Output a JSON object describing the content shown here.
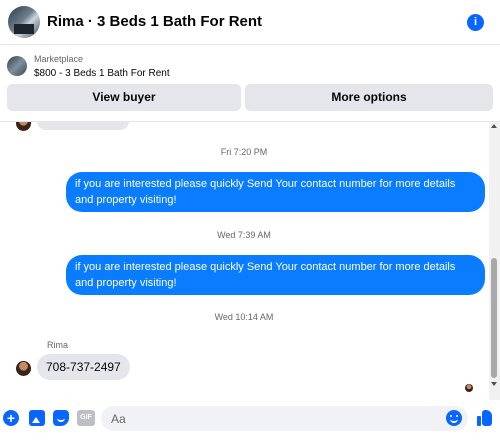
{
  "header": {
    "title": "Rima · 3 Beds 1 Bath For Rent",
    "info_icon": "info-icon"
  },
  "banner": {
    "category": "Marketplace",
    "listing": "$800 - 3 Beds 1 Bath For Rent",
    "view_buyer_label": "View buyer",
    "more_options_label": "More options"
  },
  "messages": {
    "ts1": "Fri 7:20 PM",
    "msg1": "if you are interested please quickly Send Your contact number for more details and property visiting!",
    "ts2": "Wed 7:39 AM",
    "msg2": "if you are interested please quickly Send Your contact number for more details and property visiting!",
    "ts3": "Wed 10:14 AM",
    "sender": "Rima",
    "msg3": "708-737-2497"
  },
  "composer": {
    "placeholder": "Aa",
    "gif_label": "GIF",
    "icons": [
      "plus-icon",
      "photo-icon",
      "sticker-icon",
      "gif-icon",
      "emoji-icon",
      "like-icon"
    ]
  },
  "colors": {
    "accent": "#0866ff",
    "outgoing_bubble": "#0a7cff",
    "incoming_bubble": "#e4e6eb"
  }
}
